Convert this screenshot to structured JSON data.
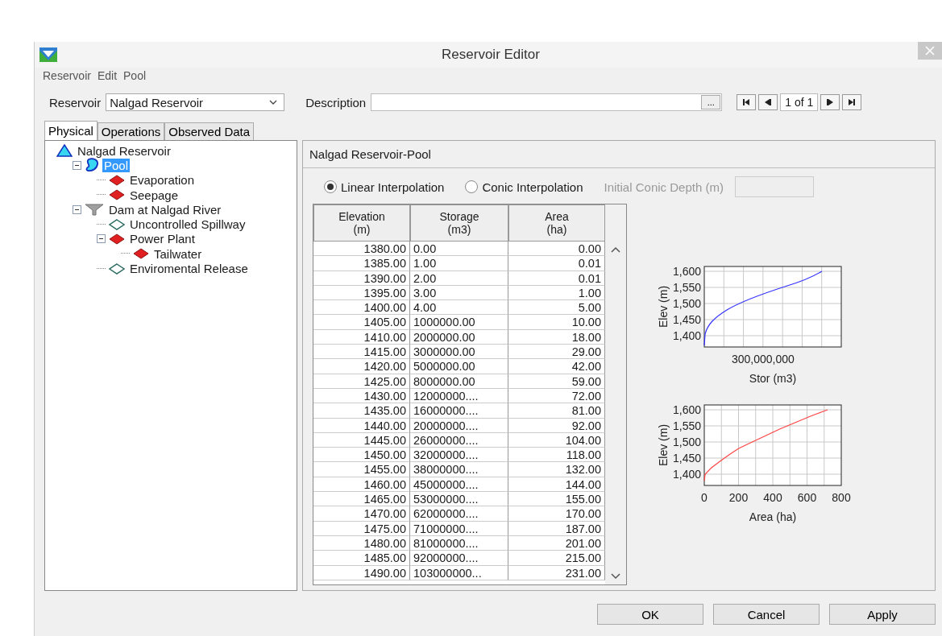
{
  "window": {
    "title": "Reservoir Editor"
  },
  "menu": [
    "Reservoir",
    "Edit",
    "Pool"
  ],
  "reservoir_selector": {
    "label": "Reservoir",
    "value": "Nalgad Reservoir"
  },
  "description": {
    "label": "Description",
    "button": "..."
  },
  "record_navigator": {
    "position": "1 of 1"
  },
  "tabs": [
    {
      "label": "Physical",
      "selected": true
    },
    {
      "label": "Operations",
      "selected": false
    },
    {
      "label": "Observed Data",
      "selected": false
    }
  ],
  "tree": [
    {
      "label": "Nalgad Reservoir",
      "kind": "reservoir",
      "selected": false,
      "children": [
        {
          "label": "Pool",
          "kind": "pool",
          "selected": true,
          "expanded": true,
          "children": [
            {
              "label": "Evaporation",
              "kind": "red_diamond",
              "selected": false
            },
            {
              "label": "Seepage",
              "kind": "red_diamond",
              "selected": false
            }
          ]
        },
        {
          "label": "Dam at Nalgad River",
          "kind": "dam",
          "selected": false,
          "expanded": true,
          "children": [
            {
              "label": "Uncontrolled Spillway",
              "kind": "outline_diamond",
              "selected": false
            },
            {
              "label": "Power Plant",
              "kind": "red_diamond",
              "selected": false,
              "expanded": true,
              "children": [
                {
                  "label": "Tailwater",
                  "kind": "red_diamond",
                  "selected": false
                }
              ]
            },
            {
              "label": "Enviromental Release",
              "kind": "outline_diamond",
              "selected": false
            }
          ]
        }
      ]
    }
  ],
  "panel": {
    "title": "Nalgad Reservoir-Pool",
    "interpolation": [
      {
        "label": "Linear Interpolation",
        "selected": true
      },
      {
        "label": "Conic Interpolation",
        "selected": false
      }
    ],
    "conic_depth": {
      "label": "Initial Conic Depth (m)",
      "disabled": true
    },
    "table": {
      "columns": [
        "Elevation\n(m)",
        "Storage\n(m3)",
        "Area\n(ha)"
      ],
      "rows": [
        [
          "1380.00",
          "0.00",
          "0.00"
        ],
        [
          "1385.00",
          "1.00",
          "0.01"
        ],
        [
          "1390.00",
          "2.00",
          "0.01"
        ],
        [
          "1395.00",
          "3.00",
          "1.00"
        ],
        [
          "1400.00",
          "4.00",
          "5.00"
        ],
        [
          "1405.00",
          "1000000.00",
          "10.00"
        ],
        [
          "1410.00",
          "2000000.00",
          "18.00"
        ],
        [
          "1415.00",
          "3000000.00",
          "29.00"
        ],
        [
          "1420.00",
          "5000000.00",
          "42.00"
        ],
        [
          "1425.00",
          "8000000.00",
          "59.00"
        ],
        [
          "1430.00",
          "12000000....",
          "72.00"
        ],
        [
          "1435.00",
          "16000000....",
          "81.00"
        ],
        [
          "1440.00",
          "20000000....",
          "92.00"
        ],
        [
          "1445.00",
          "26000000....",
          "104.00"
        ],
        [
          "1450.00",
          "32000000....",
          "118.00"
        ],
        [
          "1455.00",
          "38000000....",
          "132.00"
        ],
        [
          "1460.00",
          "45000000....",
          "144.00"
        ],
        [
          "1465.00",
          "53000000....",
          "155.00"
        ],
        [
          "1470.00",
          "62000000....",
          "170.00"
        ],
        [
          "1475.00",
          "71000000....",
          "187.00"
        ],
        [
          "1480.00",
          "81000000....",
          "201.00"
        ],
        [
          "1485.00",
          "92000000....",
          "215.00"
        ],
        [
          "1490.00",
          "103000000...",
          "231.00"
        ]
      ]
    },
    "storage_curve": {
      "ylabel": "Elev (m)",
      "xlabel": "Stor (m3)",
      "y_tick_labels": [
        "1,600",
        "1,550",
        "1,500",
        "1,450",
        "1,400"
      ],
      "x_tick_label": "300,000,000"
    },
    "charts": [
      {
        "chart_data": {
          "type": "line",
          "xlabel": "Area (ha)",
          "ylabel": "Elev (m)",
          "grid": true,
          "x": [
            0,
            5,
            42,
            92,
            144,
            201,
            280,
            360,
            440,
            530,
            620,
            720
          ],
          "series": [
            {
              "color": "#ff4444",
              "values": [
                1380,
                1400,
                1420,
                1440,
                1460,
                1480,
                1500,
                1520,
                1540,
                1560,
                1580,
                1600
              ]
            }
          ],
          "xlim": [
            0,
            800
          ],
          "ylim": [
            1365,
            1615
          ],
          "xticks": [
            0,
            200,
            400,
            600,
            800
          ],
          "yticks": [
            {
              "value": 1400,
              "label": "1,400"
            },
            {
              "value": 1450,
              "label": "1,450"
            },
            {
              "value": 1500,
              "label": "1,500"
            },
            {
              "value": 1550,
              "label": "1,550"
            },
            {
              "value": 1600,
              "label": "1,600"
            }
          ]
        }
      }
    ]
  },
  "buttons": [
    "OK",
    "Cancel",
    "Apply"
  ]
}
